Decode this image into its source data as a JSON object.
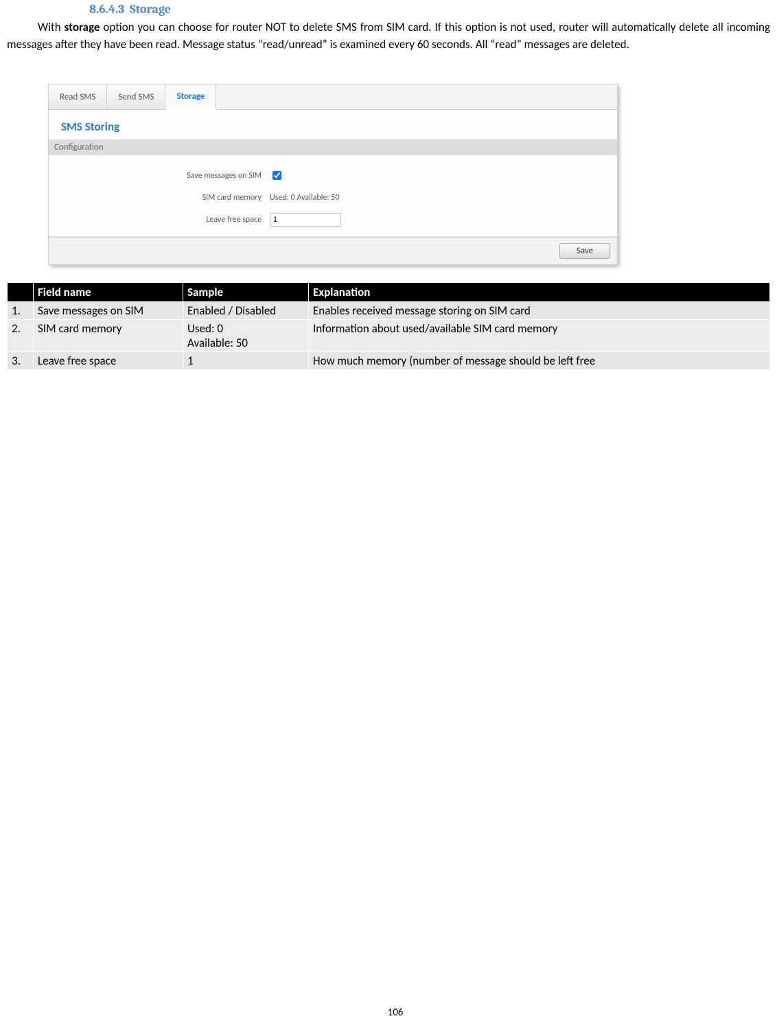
{
  "section": {
    "number": "8.6.4.3",
    "title": "Storage"
  },
  "paragraph": {
    "prefix": "With ",
    "bold": "storage",
    "rest": " option you can choose for router NOT to delete SMS from SIM card. If this option is not used, router will automatically delete all incoming messages after they have been read. Message status “read/unread” is examined every 60 seconds. All “read” messages are deleted."
  },
  "screenshot": {
    "tabs": {
      "read": "Read SMS",
      "send": "Send SMS",
      "storage": "Storage"
    },
    "panel_title": "SMS Storing",
    "config_label": "Configuration",
    "rows": {
      "save_label": "Save messages on SIM",
      "sim_label": "SIM card memory",
      "sim_value": "Used: 0  Available:  50",
      "leave_label": "Leave free space",
      "leave_value": "1"
    },
    "save_button": "Save"
  },
  "table": {
    "headers": {
      "num": "",
      "name": "Field name",
      "sample": "Sample",
      "expl": "Explanation"
    },
    "rows": [
      {
        "num": "1.",
        "name": "Save messages on SIM",
        "sample": "Enabled / Disabled",
        "expl": "Enables received message storing on SIM card"
      },
      {
        "num": "2.",
        "name": "SIM card memory",
        "sample": "Used: 0\nAvailable: 50",
        "expl": "Information about used/available SIM card memory"
      },
      {
        "num": "3.",
        "name": "Leave free space",
        "sample": "1",
        "expl": "How much memory (number of message should be left free"
      }
    ]
  },
  "page_number": "106"
}
